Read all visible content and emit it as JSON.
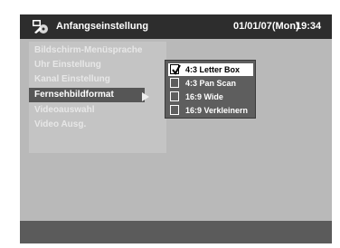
{
  "header": {
    "title": "Anfangseinstellung",
    "date": "01/01/07(Mon)",
    "time": "19:34",
    "icon": "setup-disc-icon"
  },
  "menu": {
    "items": [
      {
        "label": "Bildschirm-Menüsprache"
      },
      {
        "label": "Uhr Einstellung"
      },
      {
        "label": "Kanal Einstellung"
      },
      {
        "label": "Fernsehbildformat"
      },
      {
        "label": "Videoauswahl"
      },
      {
        "label": "Video Ausg."
      }
    ],
    "selected_index": 3,
    "arrow_icon": "triangle-right-icon"
  },
  "submenu": {
    "options": [
      {
        "label": "4:3 Letter Box",
        "checked": true
      },
      {
        "label": "4:3 Pan Scan",
        "checked": false
      },
      {
        "label": "16:9 Wide",
        "checked": false
      },
      {
        "label": "16:9 Verkleinern",
        "checked": false
      }
    ],
    "check_icon": "checkmark-icon"
  },
  "colors": {
    "screen_bg": "#b9b9b9",
    "titlebar_bg": "#2d2d2d",
    "selected_bg": "#565656",
    "submenu_bg": "#5e5e5e",
    "statusbar_bg": "#5b5b5b"
  }
}
